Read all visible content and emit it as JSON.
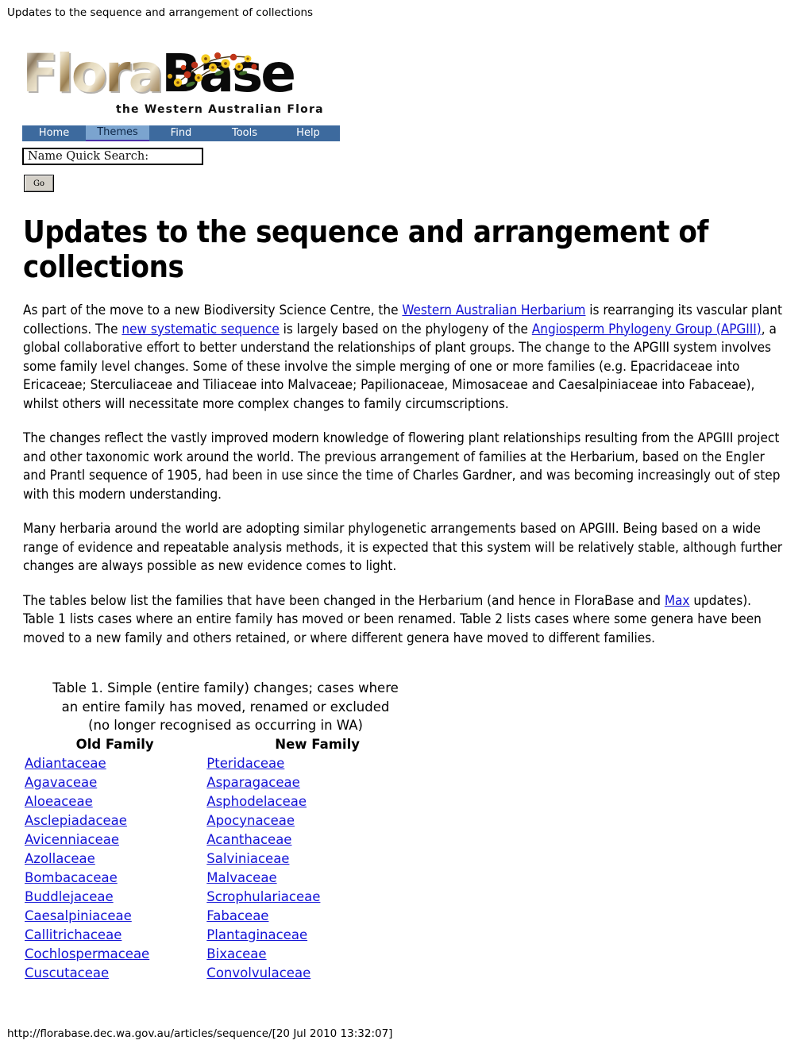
{
  "page": {
    "browser_title": "Updates to the sequence and arrangement of collections",
    "footer_url": "http://florabase.dec.wa.gov.au/articles/sequence/[20 Jul 2010 13:32:07]"
  },
  "masthead": {
    "logo_flora": "Flora",
    "logo_base": "Base",
    "tagline": "the Western Australian Flora"
  },
  "nav": {
    "items": [
      {
        "label": "Home",
        "active": false
      },
      {
        "label": "Themes",
        "active": true
      },
      {
        "label": "Find",
        "active": false
      },
      {
        "label": "Tools",
        "active": false
      },
      {
        "label": "Help",
        "active": false
      }
    ]
  },
  "search": {
    "value": "Name Quick Search:",
    "placeholder": "Name Quick Search:",
    "go_label": "Go"
  },
  "article": {
    "heading": "Updates to the sequence and arrangement of collections",
    "p1": {
      "t1": "As part of the move to a new Biodiversity Science Centre, the ",
      "link1": "Western Australian Herbarium",
      "t2": " is rearranging its vascular plant collections. The ",
      "link2": "new systematic sequence",
      "t3": " is largely based on the phylogeny of the ",
      "link3": "Angiosperm Phylogeny Group (APGIII)",
      "t4": ", a global collaborative effort to better understand the relationships of plant groups. The change to the APGIII system involves some family level changes. Some of these involve the simple merging of one or more families (e.g. Epacridaceae into Ericaceae; Sterculiaceae and Tiliaceae into Malvaceae; Papilionaceae, Mimosaceae and Caesalpiniaceae into Fabaceae), whilst others will necessitate more complex changes to family circumscriptions."
    },
    "p2": "The changes reflect the vastly improved modern knowledge of flowering plant relationships resulting from the APGIII project and other taxonomic work around the world. The previous arrangement of families at the Herbarium, based on the Engler and Prantl sequence of 1905, had been in use since the time of Charles Gardner, and was becoming increasingly out of step with this modern understanding.",
    "p3": "Many herbaria around the world are adopting similar phylogenetic arrangements based on APGIII. Being based on a wide range of evidence and repeatable analysis methods, it is expected that this system will be relatively stable, although further changes are always possible as new evidence comes to light.",
    "p4": {
      "t1": "The tables below list the families that have been changed in the Herbarium (and hence in FloraBase and ",
      "link1": "Max",
      "t2": " updates). Table 1 lists cases where an entire family has moved or been renamed. Table 2 lists cases where some genera have been moved to a new family and others retained, or where different genera have moved to different families."
    }
  },
  "table1": {
    "caption_line1": "Table 1. Simple (entire family) changes; cases where",
    "caption_line2": "an entire family has moved, renamed or excluded",
    "caption_line3": "(no longer recognised as occurring in WA)",
    "headers": [
      "Old Family",
      "New Family"
    ],
    "rows": [
      [
        "Adiantaceae",
        "Pteridaceae"
      ],
      [
        "Agavaceae",
        "Asparagaceae"
      ],
      [
        "Aloeaceae",
        "Asphodelaceae"
      ],
      [
        "Asclepiadaceae",
        "Apocynaceae"
      ],
      [
        "Avicenniaceae",
        "Acanthaceae"
      ],
      [
        "Azollaceae",
        "Salviniaceae"
      ],
      [
        "Bombacaceae",
        "Malvaceae"
      ],
      [
        "Buddlejaceae",
        "Scrophulariaceae"
      ],
      [
        "Caesalpiniaceae",
        "Fabaceae"
      ],
      [
        "Callitrichaceae",
        "Plantaginaceae"
      ],
      [
        "Cochlospermaceae",
        "Bixaceae"
      ],
      [
        "Cuscutaceae",
        "Convolvulaceae"
      ]
    ]
  },
  "colors": {
    "nav_bar": "#3d6a9e",
    "nav_active": "#7ba4cf",
    "link": "#1313d6"
  }
}
